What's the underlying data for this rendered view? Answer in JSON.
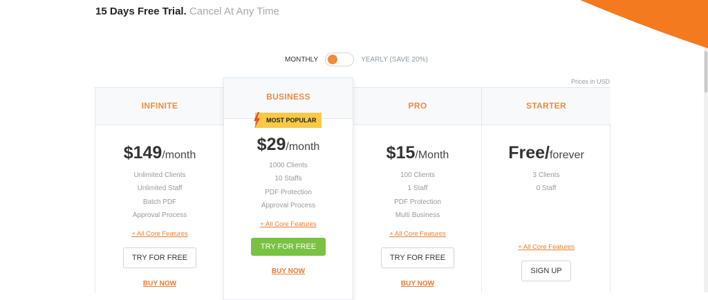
{
  "banner": {
    "trial_text": "15 Days Free Trial.",
    "cancel_text": "Cancel At Any Time"
  },
  "billing": {
    "monthly_label": "MONTHLY",
    "yearly_label": "YEARLY (SAVE 20%)",
    "selected": "monthly"
  },
  "currency_note": "Prices in USD",
  "colors": {
    "accent": "#f08a3c",
    "link": "#f07a2a",
    "green": "#7ac144",
    "badge": "#f7c948",
    "corner": "#f47a20"
  },
  "plans": [
    {
      "name": "INFINITE",
      "price": "$149",
      "period": "/month",
      "features": [
        "Unlimited Clients",
        "Unlimited Staff",
        "Batch PDF",
        "Approval Process"
      ],
      "core_link": "+ All Core Features",
      "cta": "TRY FOR FREE",
      "buy": "BUY NOW"
    },
    {
      "name": "BUSINESS",
      "badge": "MOST POPULAR",
      "badge_icon": "lightning-icon",
      "price": "$29",
      "period": "/month",
      "features": [
        "1000 Clients",
        "10 Staffs",
        "PDF Protection",
        "Approval Process"
      ],
      "core_link": "+ All Core Features",
      "cta": "TRY FOR FREE",
      "buy": "BUY NOW"
    },
    {
      "name": "PRO",
      "price": "$15",
      "period": "/Month",
      "features": [
        "100 Clients",
        "1 Staff",
        "PDF Protection",
        "Multi Business"
      ],
      "core_link": "+ All Core Features",
      "cta": "TRY FOR FREE",
      "buy": "BUY NOW"
    },
    {
      "name": "STARTER",
      "price": "Free/",
      "period": "forever",
      "features": [
        "3 Clients",
        "0 Staff"
      ],
      "core_link": "+ All Core Features",
      "cta": "SIGN UP"
    }
  ]
}
